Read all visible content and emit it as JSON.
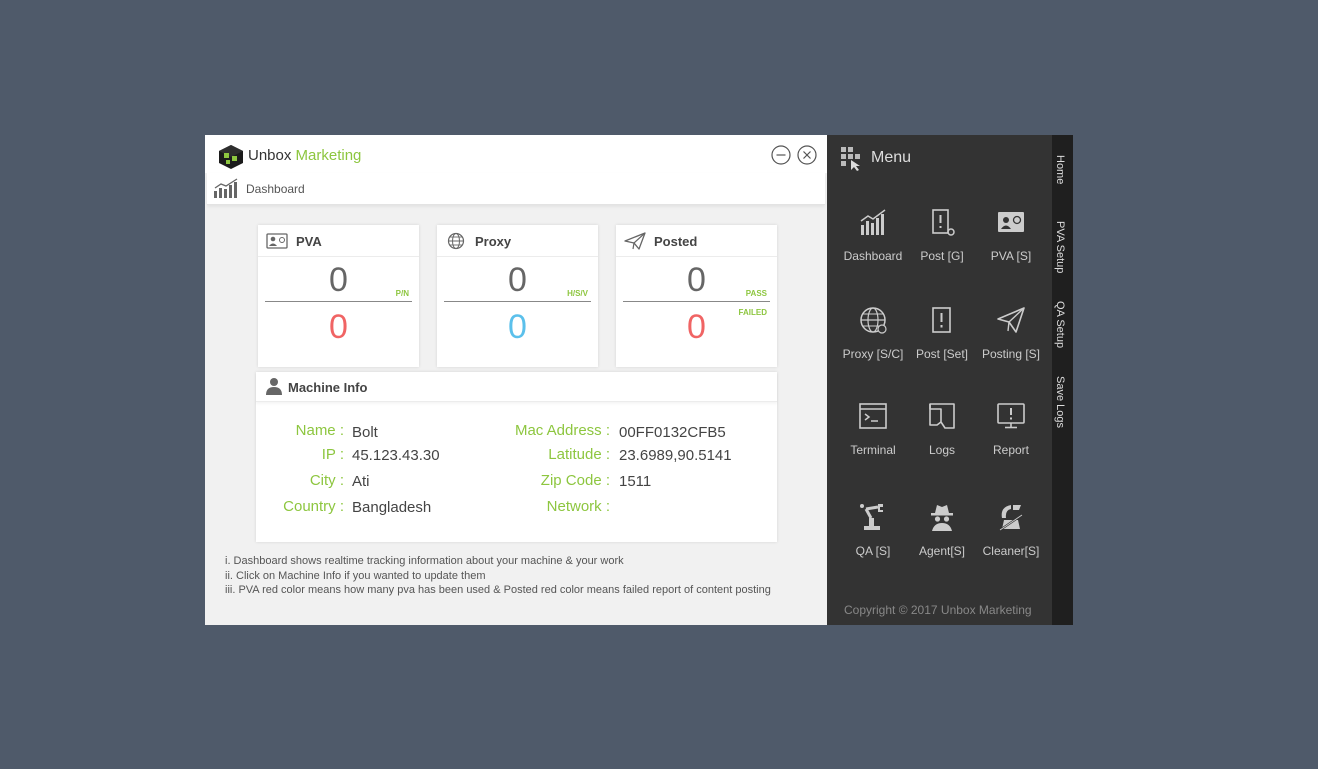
{
  "app": {
    "title_part1": "Unbox",
    "title_part2": "Marketing",
    "accent_color": "#8dc63f"
  },
  "breadcrumb": {
    "label": "Dashboard"
  },
  "cards": [
    {
      "title": "PVA",
      "icon": "id-card-icon",
      "top_value": "0",
      "top_tag": "P/N",
      "bottom_value": "0",
      "bottom_tag": ""
    },
    {
      "title": "Proxy",
      "icon": "globe-icon",
      "top_value": "0",
      "top_tag": "H/S/V",
      "bottom_value": "0",
      "bottom_tag": ""
    },
    {
      "title": "Posted",
      "icon": "paper-plane-icon",
      "top_value": "0",
      "top_tag": "PASS",
      "bottom_value": "0",
      "bottom_tag": "FAILED"
    }
  ],
  "machine_info": {
    "title": "Machine Info",
    "left": [
      {
        "label": "Name :",
        "value": "Bolt"
      },
      {
        "label": "IP :",
        "value": "45.123.43.30"
      },
      {
        "label": "City :",
        "value": "Ati"
      },
      {
        "label": "Country :",
        "value": "Bangladesh"
      }
    ],
    "right": [
      {
        "label": "Mac Address :",
        "value": "00FF0132CFB5"
      },
      {
        "label": "Latitude :",
        "value": "23.6989,90.5141"
      },
      {
        "label": "Zip Code :",
        "value": "1511"
      },
      {
        "label": "Network :",
        "value": ""
      }
    ]
  },
  "notes": [
    "i.   Dashboard shows realtime tracking information about your machine & your work",
    "ii.  Click on Machine Info if you wanted to update them",
    "iii. PVA red color means how many pva has been used & Posted red color means failed report of content posting"
  ],
  "menu": {
    "title": "Menu",
    "items": [
      {
        "label": "Dashboard",
        "icon": "bar-chart-icon"
      },
      {
        "label": "Post [G]",
        "icon": "post-gear-icon"
      },
      {
        "label": "PVA [S]",
        "icon": "id-card-icon"
      },
      {
        "label": "Proxy [S/C]",
        "icon": "globe-www-icon"
      },
      {
        "label": "Post [Set]",
        "icon": "post-alert-icon"
      },
      {
        "label": "Posting [S]",
        "icon": "paper-plane-icon"
      },
      {
        "label": "Terminal",
        "icon": "terminal-icon"
      },
      {
        "label": "Logs",
        "icon": "logs-icon"
      },
      {
        "label": "Report",
        "icon": "report-icon"
      },
      {
        "label": "QA [S]",
        "icon": "robot-arm-icon"
      },
      {
        "label": "Agent[S]",
        "icon": "spy-agent-icon"
      },
      {
        "label": "Cleaner[S]",
        "icon": "cleaner-icon"
      }
    ],
    "copyright": "Copyright © 2017 Unbox Marketing"
  },
  "side_tabs": [
    "Home",
    "PVA Setup",
    "QA Setup",
    "Save Logs"
  ],
  "colors": {
    "menu_bg": "#333333",
    "red_value": "#f06464",
    "blue_value": "#5bc0eb",
    "desktop_bg": "#4f5a6a"
  }
}
